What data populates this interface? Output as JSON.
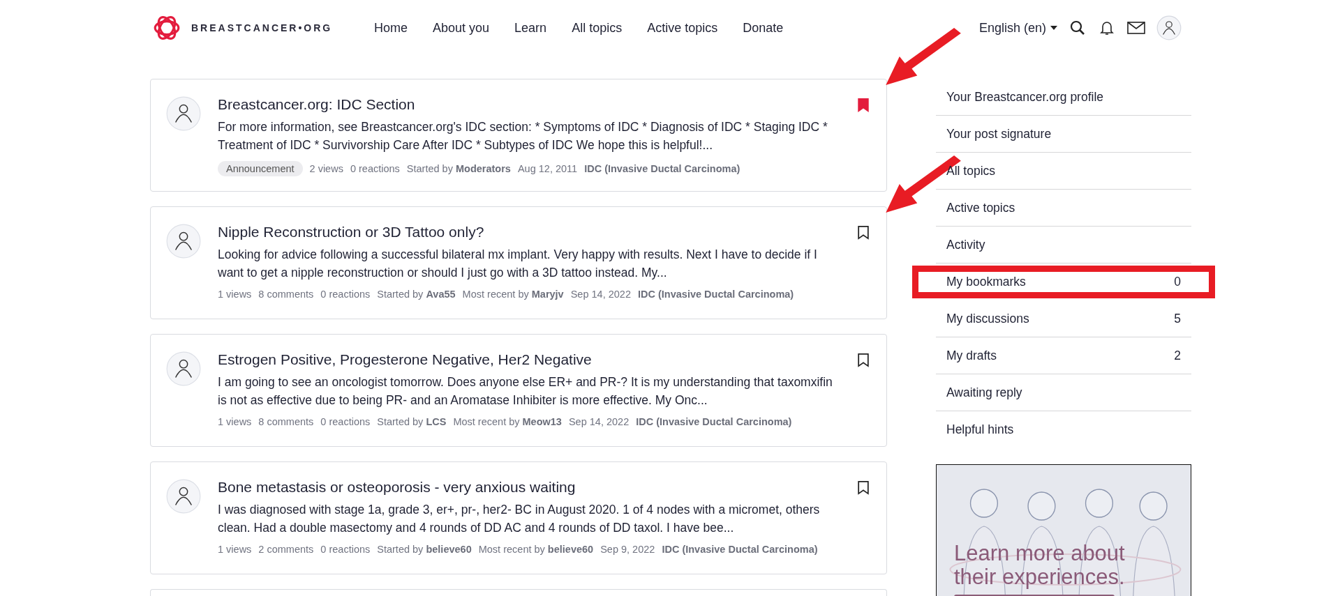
{
  "header": {
    "logo_text": "BREASTCANCER•ORG",
    "nav": [
      {
        "label": "Home"
      },
      {
        "label": "About you"
      },
      {
        "label": "Learn"
      },
      {
        "label": "All topics"
      },
      {
        "label": "Active topics"
      },
      {
        "label": "Donate"
      }
    ],
    "language": "English (en)"
  },
  "discussions": [
    {
      "title": "Breastcancer.org: IDC Section",
      "excerpt": "For more information, see Breastcancer.org's IDC section: * Symptoms of IDC * Diagnosis of IDC * Staging IDC * Treatment of IDC * Survivorship Care After IDC * Subtypes of IDC We hope this is helpful!...",
      "bookmarked": true,
      "arrow_pointer": true,
      "tag": "Announcement",
      "meta": [
        {
          "text": "2 views"
        },
        {
          "text": "0 reactions"
        },
        {
          "text": "Started by **Moderators**"
        },
        {
          "text": "Aug 12, 2011"
        },
        {
          "text": "**IDC (Invasive Ductal Carcinoma)**"
        }
      ]
    },
    {
      "title": "Nipple Reconstruction or 3D Tattoo only?",
      "excerpt": "Looking for advice following a successful bilateral mx implant. Very happy with results. Next I have to decide if I want to get a nipple reconstruction or should I just go with a 3D tattoo instead. My...",
      "bookmarked": false,
      "arrow_pointer": true,
      "meta": [
        {
          "text": "1 views"
        },
        {
          "text": "8 comments"
        },
        {
          "text": "0 reactions"
        },
        {
          "text": "Started by **Ava55**"
        },
        {
          "text": "Most recent by **Maryjv**"
        },
        {
          "text": "Sep 14, 2022"
        },
        {
          "text": "**IDC (Invasive Ductal Carcinoma)**"
        }
      ]
    },
    {
      "title": "Estrogen Positive, Progesterone Negative, Her2 Negative",
      "excerpt": "I am going to see an oncologist tomorrow. Does anyone else ER+ and PR-? It is my understanding that taxomxifin is not as effective due to being PR- and an Aromatase Inhibiter is more effective. My Onc...",
      "bookmarked": false,
      "arrow_pointer": false,
      "meta": [
        {
          "text": "1 views"
        },
        {
          "text": "8 comments"
        },
        {
          "text": "0 reactions"
        },
        {
          "text": "Started by **LCS**"
        },
        {
          "text": "Most recent by **Meow13**"
        },
        {
          "text": "Sep 14, 2022"
        },
        {
          "text": "**IDC (Invasive Ductal Carcinoma)**"
        }
      ]
    },
    {
      "title": "Bone metastasis or osteoporosis - very anxious waiting",
      "excerpt": "I was diagnosed with stage 1a, grade 3, er+, pr-, her2- BC in August 2020. 1 of 4 nodes with a micromet, others clean. Had a double masectomy and 4 rounds of DD AC and 4 rounds of DD taxol. I have bee...",
      "bookmarked": false,
      "arrow_pointer": false,
      "meta": [
        {
          "text": "1 views"
        },
        {
          "text": "2 comments"
        },
        {
          "text": "0 reactions"
        },
        {
          "text": "Started by **believe60**"
        },
        {
          "text": "Most recent by **believe60**"
        },
        {
          "text": "Sep 9, 2022"
        },
        {
          "text": "**IDC (Invasive Ductal Carcinoma)**"
        }
      ]
    }
  ],
  "sidebar": {
    "items": [
      {
        "label": "Your Breastcancer.org profile",
        "highlighted": false
      },
      {
        "label": "Your post signature",
        "highlighted": false
      },
      {
        "label": "All topics",
        "highlighted": false
      },
      {
        "label": "Active topics",
        "highlighted": false
      },
      {
        "label": "Activity",
        "highlighted": false
      },
      {
        "label": "My bookmarks",
        "count": "0",
        "highlighted": true
      },
      {
        "label": "My discussions",
        "count": "5",
        "highlighted": false
      },
      {
        "label": "My drafts",
        "count": "2",
        "highlighted": false
      },
      {
        "label": "Awaiting reply",
        "highlighted": false
      },
      {
        "label": "Helpful hints",
        "highlighted": false
      }
    ],
    "ad": {
      "kind": "picture",
      "headline": "Learn more about their experiences."
    }
  }
}
